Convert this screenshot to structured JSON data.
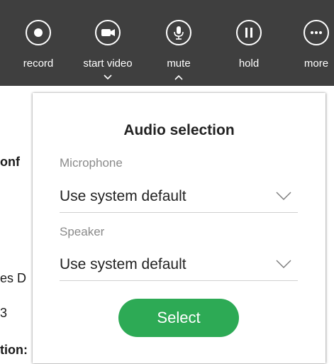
{
  "toolbar": {
    "record_label": "record",
    "start_video_label": "start video",
    "mute_label": "mute",
    "hold_label": "hold",
    "more_label": "more"
  },
  "background": {
    "line1": "onf",
    "line2": "es D",
    "line3": "3",
    "line4": "tion:"
  },
  "audio_popover": {
    "title": "Audio selection",
    "microphone_label": "Microphone",
    "microphone_value": "Use system default",
    "speaker_label": "Speaker",
    "speaker_value": "Use system default",
    "select_button": "Select"
  },
  "colors": {
    "toolbar_bg": "#3f3f3f",
    "select_button_bg": "#2daa55"
  },
  "icons": [
    "record-icon",
    "video-camera-icon",
    "microphone-icon",
    "pause-icon",
    "more-dots-icon",
    "chevron-down-icon",
    "chevron-up-icon"
  ]
}
